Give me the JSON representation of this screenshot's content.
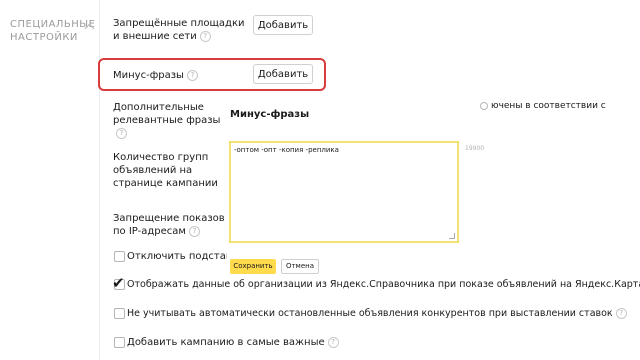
{
  "section": {
    "title": "Специальные настройки"
  },
  "rows": {
    "blocked": {
      "label": "Запрещённые площадки и внешние сети",
      "button": "Добавить"
    },
    "minus": {
      "label": "Минус-фразы",
      "button": "Добавить"
    },
    "extra": {
      "label": "Дополнительные релевантные фразы"
    },
    "groups": {
      "label": "Количество групп объявлений на странице кампании"
    },
    "ipban": {
      "label": "Запрещение показов по IP-адресам"
    }
  },
  "popup": {
    "title": "Минус-фразы",
    "hint": "ючены в соответствии с",
    "text": "-оптом -опт -копия -реплика",
    "counter": "19900",
    "save": "Сохранить",
    "cancel": "Отмена"
  },
  "checkboxes": [
    {
      "label": "Отключить подстанов",
      "checked": false
    },
    {
      "label": "Отображать данные об организации из Яндекс.Справочника при показе объявлений на Яндекс.Картах",
      "checked": true
    },
    {
      "label": "Не учитывать автоматически остановленные объявления конкурентов при выставлении ставок",
      "checked": false
    },
    {
      "label": "Добавить кампанию в самые важные",
      "checked": false
    }
  ],
  "icons": {
    "help": "?",
    "check": "✔"
  },
  "colors": {
    "highlight": "#d93a3a",
    "accent": "#ffdb4d",
    "textarea_border": "#f3e173"
  }
}
